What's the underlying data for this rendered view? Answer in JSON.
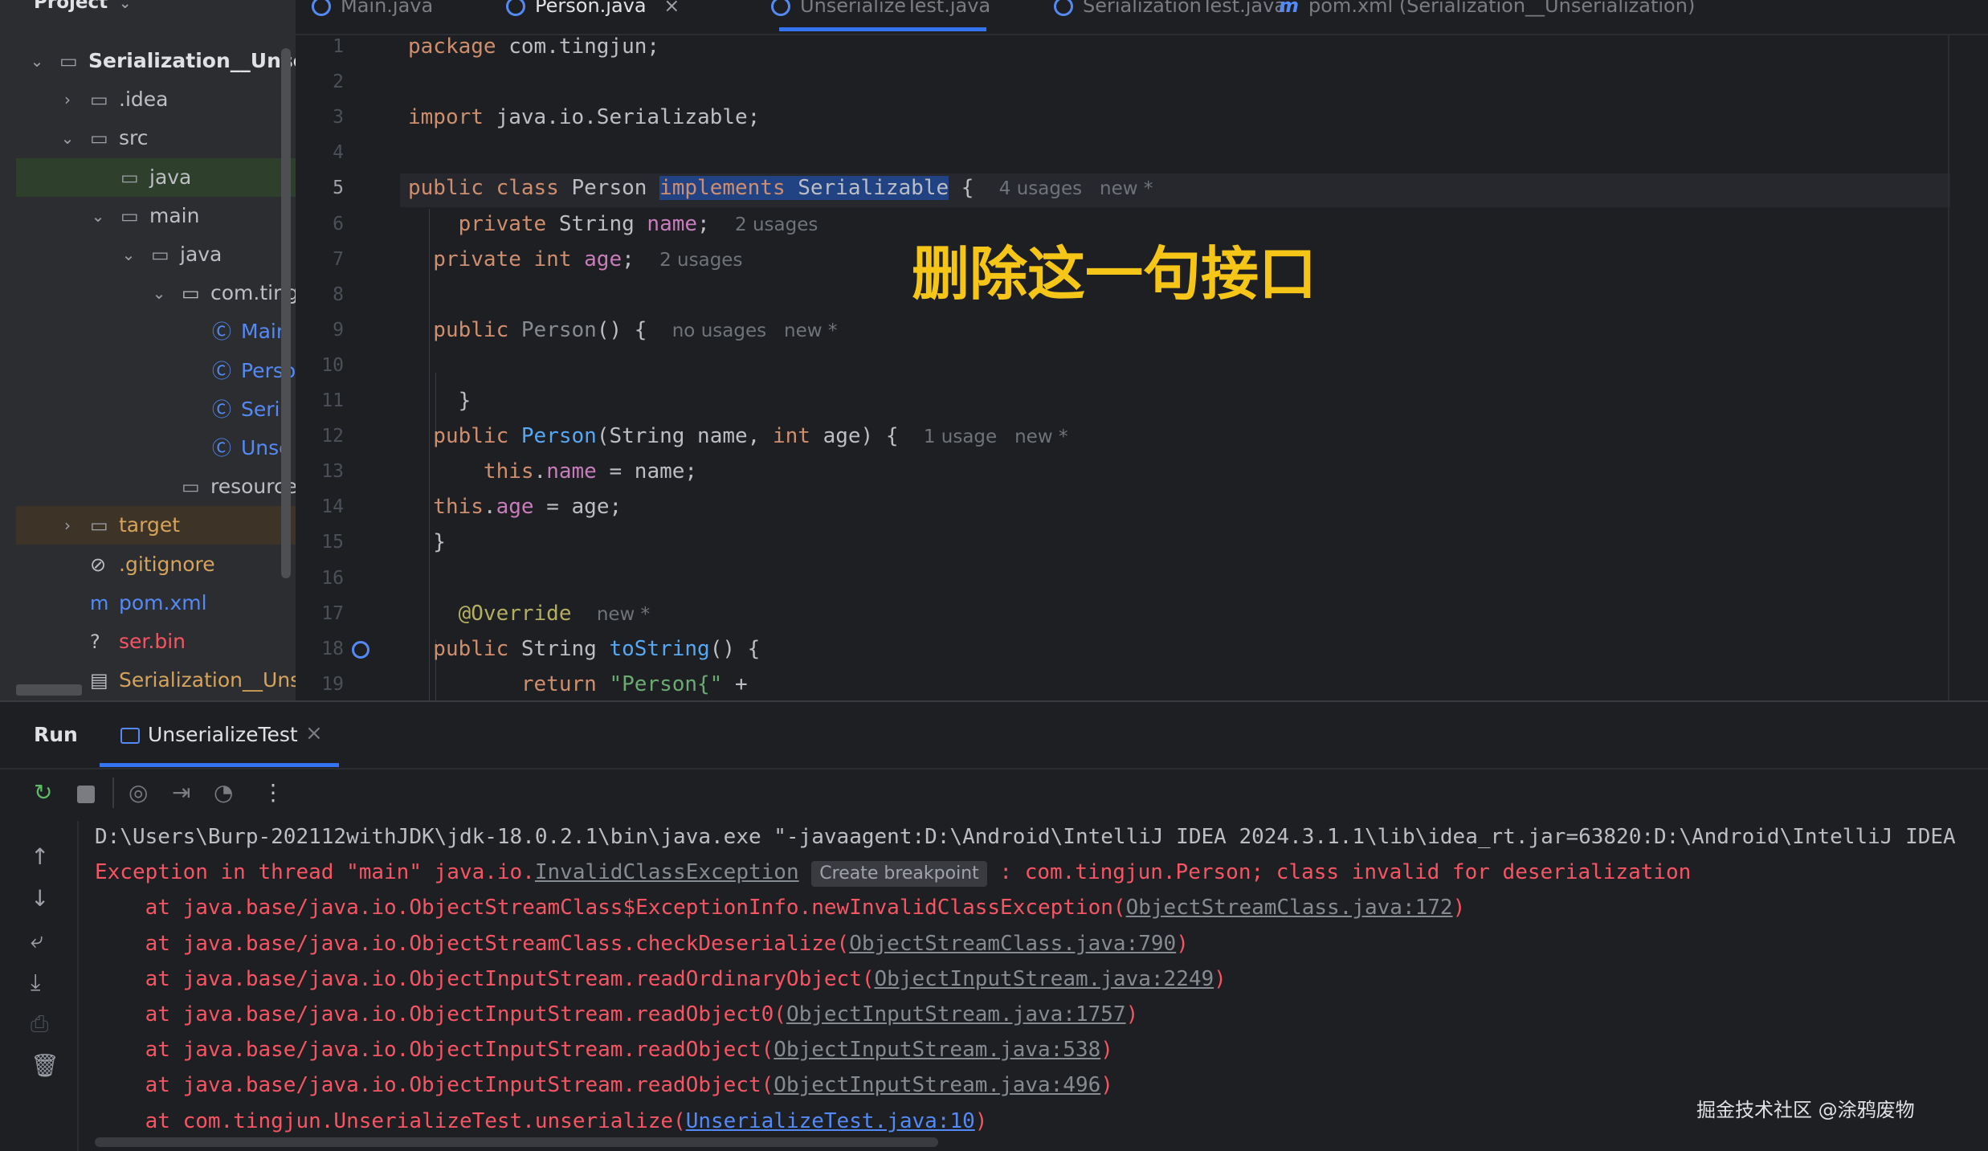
{
  "project": {
    "title": "Project",
    "tree": [
      {
        "label": "Serialization__Unser",
        "icon": "module-folder-icon",
        "indent": 0,
        "arrow": "down",
        "bold": true
      },
      {
        "label": ".idea",
        "icon": "folder-icon",
        "indent": 1,
        "arrow": "right"
      },
      {
        "label": "src",
        "icon": "folder-icon",
        "indent": 1,
        "arrow": "down"
      },
      {
        "label": "java",
        "icon": "source-folder-icon",
        "indent": 2,
        "arrow": "",
        "highlight": "green"
      },
      {
        "label": "main",
        "icon": "package-folder-icon",
        "indent": 2,
        "arrow": "down"
      },
      {
        "label": "java",
        "icon": "source-folder-icon",
        "indent": 3,
        "arrow": "down"
      },
      {
        "label": "com.ting",
        "icon": "package-icon",
        "indent": 4,
        "arrow": "down"
      },
      {
        "label": "Main",
        "icon": "class-runnable-icon",
        "indent": 5,
        "arrow": "",
        "color": "#548af7"
      },
      {
        "label": "Perso",
        "icon": "class-icon",
        "indent": 5,
        "arrow": "",
        "color": "#548af7"
      },
      {
        "label": "Seria",
        "icon": "class-runnable-icon",
        "indent": 5,
        "arrow": "",
        "color": "#548af7"
      },
      {
        "label": "Unse",
        "icon": "class-runnable-icon",
        "indent": 5,
        "arrow": "",
        "color": "#548af7"
      },
      {
        "label": "resources",
        "icon": "resources-folder-icon",
        "indent": 4,
        "arrow": ""
      },
      {
        "label": "target",
        "icon": "folder-icon",
        "indent": 1,
        "arrow": "right",
        "highlight": "brown",
        "color": "#d5a35b"
      },
      {
        "label": ".gitignore",
        "icon": "ignore-file-icon",
        "indent": 1,
        "arrow": "",
        "color": "#d5a35b"
      },
      {
        "label": "pom.xml",
        "icon": "maven-icon",
        "indent": 1,
        "arrow": "",
        "color": "#548af7"
      },
      {
        "label": "ser.bin",
        "icon": "unknown-file-icon",
        "indent": 1,
        "arrow": "",
        "color": "#f75464"
      },
      {
        "label": "Serialization__Uns",
        "icon": "iml-file-icon",
        "indent": 1,
        "arrow": "",
        "color": "#d5a35b"
      }
    ]
  },
  "tabs": [
    {
      "label": "Main.java",
      "active": false
    },
    {
      "label": "Person.java",
      "active": true,
      "close": "×"
    },
    {
      "label": "UnserializeTest.java",
      "active": false
    },
    {
      "label": "SerializationTest.java",
      "active": false
    },
    {
      "label": "pom.xml (Serialization__Unserialization)",
      "active": false,
      "icon": "maven-icon"
    }
  ],
  "editor": {
    "line_numbers": [
      "1",
      "2",
      "3",
      "4",
      "5",
      "6",
      "7",
      "8",
      "9",
      "10",
      "11",
      "12",
      "13",
      "14",
      "15",
      "16",
      "17",
      "18",
      "19"
    ],
    "current_line": "5",
    "annotation_text": "删除这一句接口",
    "lines": [
      [
        {
          "t": "package ",
          "c": "kw"
        },
        {
          "t": "com.tingjun;",
          "c": ""
        }
      ],
      [],
      [
        {
          "t": "import ",
          "c": "kw"
        },
        {
          "t": "java.io.Serializable;",
          "c": ""
        }
      ],
      [],
      [
        {
          "t": "public class ",
          "c": "kw"
        },
        {
          "t": "Person ",
          "c": ""
        },
        {
          "t": "implements",
          "c": "kw sel"
        },
        {
          "t": " ",
          "c": "sel"
        },
        {
          "t": "Serializable",
          "c": "sel"
        },
        {
          "t": " {  ",
          "c": ""
        },
        {
          "t": "4 usages   new *",
          "c": "hint"
        }
      ],
      [
        {
          "t": "    private ",
          "c": "kw"
        },
        {
          "t": "String ",
          "c": ""
        },
        {
          "t": "name",
          "c": "fld"
        },
        {
          "t": ";  ",
          "c": ""
        },
        {
          "t": "2 usages",
          "c": "hint"
        }
      ],
      [
        {
          "t": "  private int ",
          "c": "kw"
        },
        {
          "t": "age",
          "c": "fld"
        },
        {
          "t": ";  ",
          "c": ""
        },
        {
          "t": "2 usages",
          "c": "hint"
        }
      ],
      [],
      [
        {
          "t": "  public ",
          "c": "kw"
        },
        {
          "t": "Person",
          "c": "grey"
        },
        {
          "t": "() {  ",
          "c": ""
        },
        {
          "t": "no usages   new *",
          "c": "hint"
        }
      ],
      [],
      [
        {
          "t": "    }",
          "c": ""
        }
      ],
      [
        {
          "t": "  public ",
          "c": "kw"
        },
        {
          "t": "Person",
          "c": "fn"
        },
        {
          "t": "(String name, ",
          "c": ""
        },
        {
          "t": "int ",
          "c": "kw"
        },
        {
          "t": "age) {  ",
          "c": ""
        },
        {
          "t": "1 usage   new *",
          "c": "hint"
        }
      ],
      [
        {
          "t": "      this",
          "c": "kw"
        },
        {
          "t": ".",
          "c": ""
        },
        {
          "t": "name",
          "c": "fld"
        },
        {
          "t": " = name;",
          "c": ""
        }
      ],
      [
        {
          "t": "  this",
          "c": "kw"
        },
        {
          "t": ".",
          "c": ""
        },
        {
          "t": "age",
          "c": "fld"
        },
        {
          "t": " = age;",
          "c": ""
        }
      ],
      [
        {
          "t": "  }",
          "c": ""
        }
      ],
      [],
      [
        {
          "t": "    @Override",
          "c": "ann"
        },
        {
          "t": "  ",
          "c": ""
        },
        {
          "t": "new *",
          "c": "hint"
        }
      ],
      [
        {
          "t": "  public ",
          "c": "kw"
        },
        {
          "t": "String ",
          "c": ""
        },
        {
          "t": "toString",
          "c": "fn"
        },
        {
          "t": "() {",
          "c": ""
        }
      ],
      [
        {
          "t": "         return ",
          "c": "kw"
        },
        {
          "t": "\"Person{\"",
          "c": "str"
        },
        {
          "t": " +",
          "c": ""
        }
      ]
    ]
  },
  "run": {
    "title": "Run",
    "tab_label": "UnserializeTest",
    "tab_close": "×",
    "console": [
      [
        {
          "t": "D:\\Users\\Burp-202112withJDK\\jdk-18.0.2.1\\bin\\java.exe \"-javaagent:D:\\Android\\IntelliJ IDEA 2024.3.1.1\\lib\\idea_rt.jar=63820:D:\\Android\\IntelliJ IDEA",
          "c": "cmd"
        }
      ],
      [
        {
          "t": "Exception in thread \"main\" java.io.",
          "c": "err"
        },
        {
          "t": "InvalidClassException",
          "c": "link"
        },
        {
          "t": " ",
          "c": ""
        },
        {
          "t": "Create breakpoint",
          "c": "bp"
        },
        {
          "t": " : com.tingjun.Person; class invalid for deserialization",
          "c": "err"
        }
      ],
      [
        {
          "t": "    at java.base/java.io.ObjectStreamClass$ExceptionInfo.newInvalidClassException(",
          "c": "err"
        },
        {
          "t": "ObjectStreamClass.java:172",
          "c": "link"
        },
        {
          "t": ")",
          "c": "err"
        }
      ],
      [
        {
          "t": "    at java.base/java.io.ObjectStreamClass.checkDeserialize(",
          "c": "err"
        },
        {
          "t": "ObjectStreamClass.java:790",
          "c": "link"
        },
        {
          "t": ")",
          "c": "err"
        }
      ],
      [
        {
          "t": "    at java.base/java.io.ObjectInputStream.readOrdinaryObject(",
          "c": "err"
        },
        {
          "t": "ObjectInputStream.java:2249",
          "c": "link"
        },
        {
          "t": ")",
          "c": "err"
        }
      ],
      [
        {
          "t": "    at java.base/java.io.ObjectInputStream.readObject0(",
          "c": "err"
        },
        {
          "t": "ObjectInputStream.java:1757",
          "c": "link"
        },
        {
          "t": ")",
          "c": "err"
        }
      ],
      [
        {
          "t": "    at java.base/java.io.ObjectInputStream.readObject(",
          "c": "err"
        },
        {
          "t": "ObjectInputStream.java:538",
          "c": "link"
        },
        {
          "t": ")",
          "c": "err"
        }
      ],
      [
        {
          "t": "    at java.base/java.io.ObjectInputStream.readObject(",
          "c": "err"
        },
        {
          "t": "ObjectInputStream.java:496",
          "c": "link"
        },
        {
          "t": ")",
          "c": "err"
        }
      ],
      [
        {
          "t": "    at com.tingjun.UnserializeTest.unserialize(",
          "c": "err"
        },
        {
          "t": "UnserializeTest.java:10",
          "c": "link-blue"
        },
        {
          "t": ")",
          "c": "err"
        }
      ]
    ]
  },
  "watermark": "掘金技术社区 @涂鸦废物",
  "colors": {
    "accent": "#3574f0",
    "error": "#f75464",
    "keyword": "#cf8e6d",
    "annotation": "#f5c518"
  }
}
